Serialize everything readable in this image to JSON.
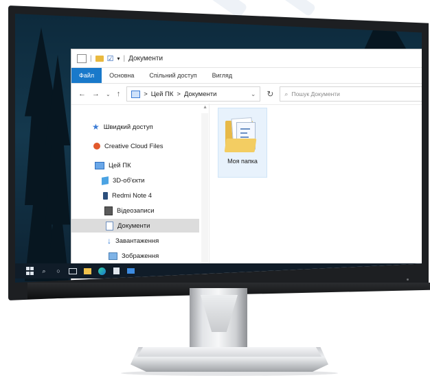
{
  "window": {
    "title": "Документи",
    "ribbon_tabs": [
      "Файл",
      "Основна",
      "Спільний доступ",
      "Вигляд"
    ],
    "address": {
      "path_root": "Цей ПК",
      "path_current": "Документи",
      "separator": ">"
    },
    "search": {
      "placeholder": "Пошук Документи"
    },
    "nav": {
      "quick_access": "Швидкий доступ",
      "creative_cloud": "Creative Cloud Files",
      "this_pc": "Цей ПК",
      "objects_3d": "3D-об'єкти",
      "phone": "Redmi Note 4",
      "videos": "Відеозаписи",
      "documents": "Документи",
      "downloads": "Завантаження",
      "pictures": "Зображення"
    },
    "folder": {
      "name": "Моя папка"
    }
  },
  "icons": {
    "quick_access": "star-icon",
    "creative_cloud": "creative-cloud-icon",
    "this_pc": "computer-icon",
    "objects_3d": "cube-icon",
    "phone": "phone-icon",
    "videos": "video-icon",
    "documents": "document-icon",
    "downloads": "download-arrow-icon",
    "pictures": "image-icon"
  },
  "colors": {
    "accent": "#1979ca",
    "taskbar": "#101c28",
    "wallpaper": "#14384d",
    "folder": "#e7b948"
  }
}
